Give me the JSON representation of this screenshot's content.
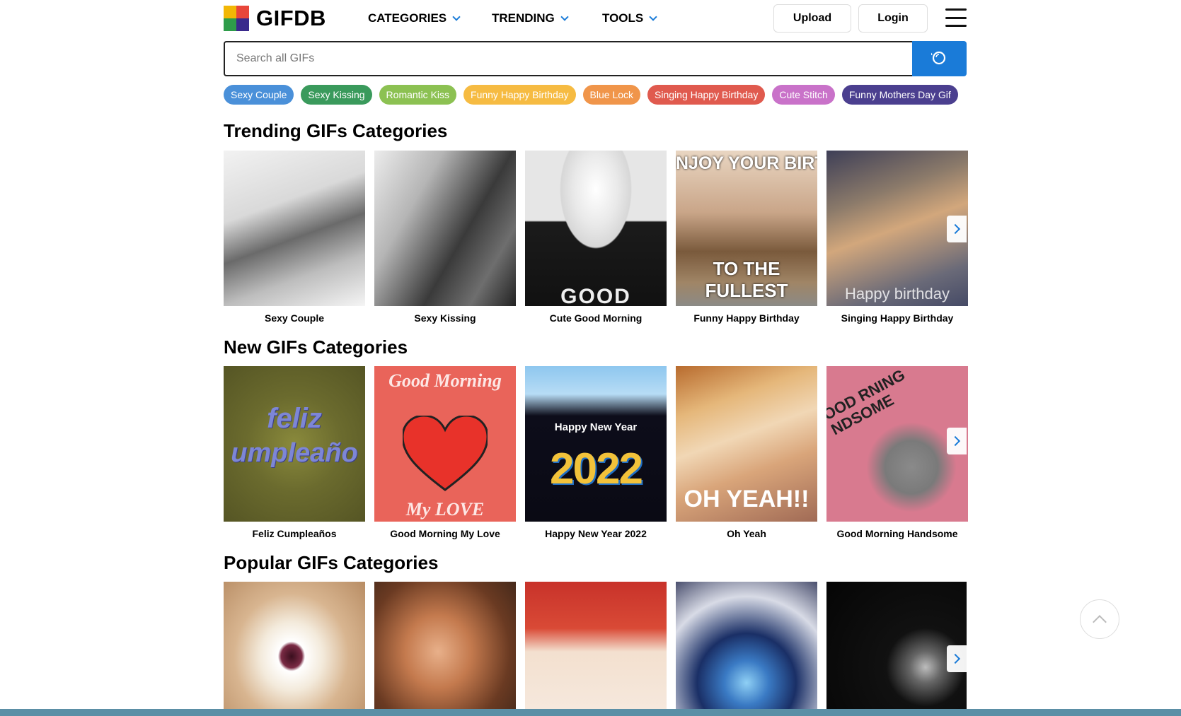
{
  "header": {
    "logo_text": "GIFDB",
    "nav": [
      {
        "label": "CATEGORIES"
      },
      {
        "label": "TRENDING"
      },
      {
        "label": "TOOLS"
      }
    ],
    "upload_label": "Upload",
    "login_label": "Login"
  },
  "search": {
    "placeholder": "Search all GIFs"
  },
  "tags": [
    {
      "label": "Sexy Couple",
      "color": "#4a90d9"
    },
    {
      "label": "Sexy Kissing",
      "color": "#3a9a5c"
    },
    {
      "label": "Romantic Kiss",
      "color": "#8cc152"
    },
    {
      "label": "Funny Happy Birthday",
      "color": "#f6bb42"
    },
    {
      "label": "Blue Lock",
      "color": "#f0954a"
    },
    {
      "label": "Singing Happy Birthday",
      "color": "#e05a4e"
    },
    {
      "label": "Cute Stitch",
      "color": "#c972c9"
    },
    {
      "label": "Funny Mothers Day Gif",
      "color": "#4b3f8f"
    }
  ],
  "sections": {
    "trending": {
      "title": "Trending GIFs Categories",
      "items": [
        {
          "caption": "Sexy Couple"
        },
        {
          "caption": "Sexy Kissing"
        },
        {
          "caption": "Cute Good Morning",
          "overlay": "GOOD"
        },
        {
          "caption": "Funny Happy Birthday",
          "overlay_top": "NJOY YOUR BIRTHDA",
          "overlay_bottom": "TO THE FULLEST"
        },
        {
          "caption": "Singing Happy Birthday",
          "overlay": "Happy birthday"
        }
      ]
    },
    "new": {
      "title": "New GIFs Categories",
      "items": [
        {
          "caption": "Feliz Cumpleaños",
          "overlay_top": "feliz",
          "overlay_bottom": "umpleaño"
        },
        {
          "caption": "Good Morning My Love",
          "overlay_top": "Good Morning",
          "overlay_bottom": "My LOVE"
        },
        {
          "caption": "Happy New Year 2022",
          "overlay_top": "Happy New Year",
          "overlay_bottom": "2022"
        },
        {
          "caption": "Oh Yeah",
          "overlay": "OH YEAH!!"
        },
        {
          "caption": "Good Morning Handsome",
          "overlay": "OOD RNING NDSOME"
        }
      ]
    },
    "popular": {
      "title": "Popular GIFs Categories"
    }
  }
}
